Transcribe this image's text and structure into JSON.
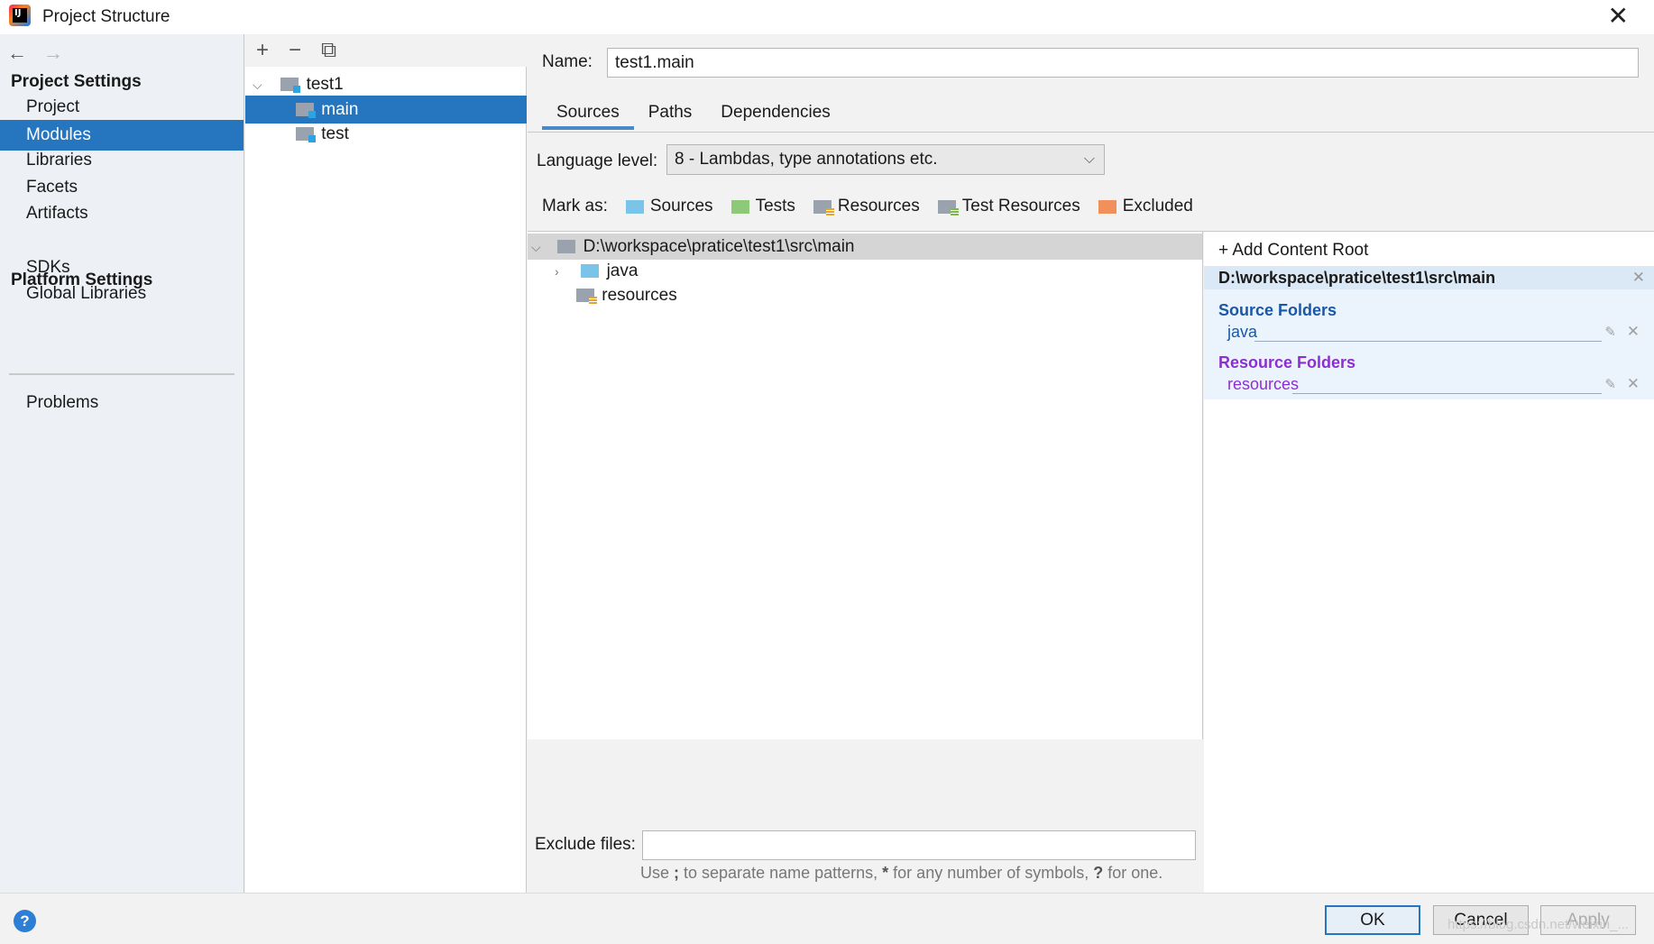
{
  "window": {
    "title": "Project Structure",
    "close": "✕"
  },
  "nav": {
    "back": "←",
    "forward": "→",
    "project_settings": "Project Settings",
    "items_project": [
      "Project",
      "Modules",
      "Libraries",
      "Facets",
      "Artifacts"
    ],
    "platform_settings": "Platform Settings",
    "items_platform": [
      "SDKs",
      "Global Libraries"
    ],
    "problems": "Problems",
    "selected": "Modules"
  },
  "module_tree": {
    "toolbar": {
      "add": "+",
      "remove": "−",
      "copy": "⧉"
    },
    "root": "test1",
    "children": [
      "main",
      "test"
    ],
    "selected": "main"
  },
  "module": {
    "name_label": "Name:",
    "name_value": "test1.main",
    "tabs": [
      "Sources",
      "Paths",
      "Dependencies"
    ],
    "active_tab": "Sources",
    "language_level_label": "Language level:",
    "language_level_value": "8 - Lambdas, type annotations etc.",
    "mark_as_label": "Mark as:",
    "mark_as": [
      "Sources",
      "Tests",
      "Resources",
      "Test Resources",
      "Excluded"
    ]
  },
  "content_tree": {
    "root": "D:\\workspace\\pratice\\test1\\src\\main",
    "children": [
      "java",
      "resources"
    ]
  },
  "content_root_panel": {
    "add_content_root": "Add Content Root",
    "root_path": "D:\\workspace\\pratice\\test1\\src\\main",
    "source_folders_title": "Source Folders",
    "source_folders": [
      "java"
    ],
    "resource_folders_title": "Resource Folders",
    "resource_folders": [
      "resources"
    ]
  },
  "exclude": {
    "label": "Exclude files:",
    "value": "",
    "hint_a": "Use ",
    "hint_sep": ";",
    "hint_b": " to separate name patterns, ",
    "hint_star": "*",
    "hint_c": " for any number of symbols, ",
    "hint_q": "?",
    "hint_d": " for one."
  },
  "buttons": {
    "help": "?",
    "ok": "OK",
    "cancel": "Cancel",
    "apply": "Apply"
  },
  "watermark": "https://blog.csdn.net/weixin_..."
}
